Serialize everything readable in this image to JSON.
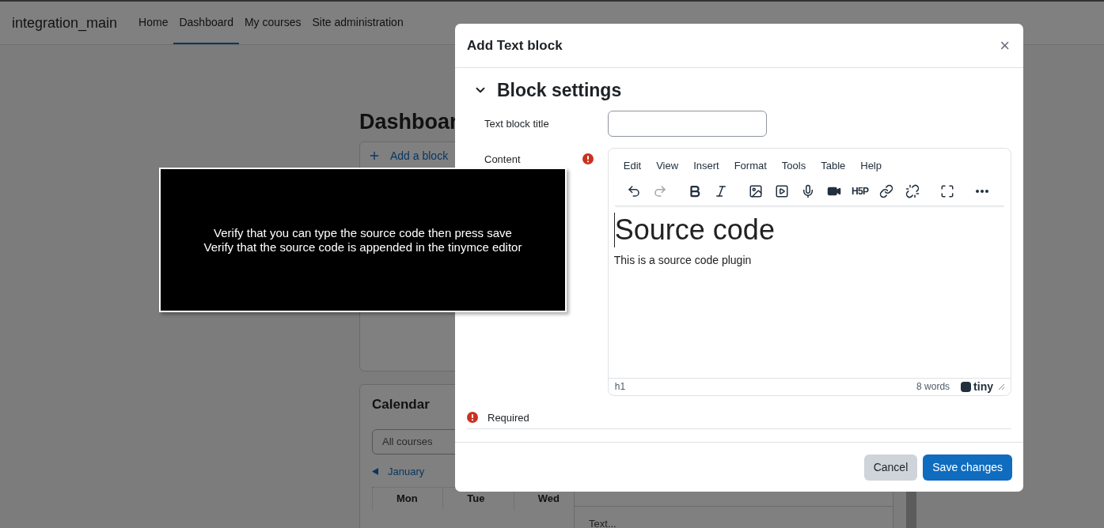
{
  "navbar": {
    "brand": "integration_main",
    "items": [
      {
        "label": "Home",
        "selected": false
      },
      {
        "label": "Dashboard",
        "selected": true
      },
      {
        "label": "My courses",
        "selected": false
      },
      {
        "label": "Site administration",
        "selected": false
      }
    ]
  },
  "page": {
    "title": "Dashboar",
    "add_block": "Add a block",
    "calendar": {
      "title": "Calendar",
      "course_filter": "All courses",
      "month_link": "January",
      "weekdays": [
        "Mon",
        "Tue",
        "Wed"
      ]
    },
    "block_menu": {
      "items": [
        "Text..."
      ]
    }
  },
  "overlay": {
    "lines": [
      "Verify that you can type the source code then press save",
      "Verify that the source code is appended in the tinymce editor"
    ]
  },
  "modal": {
    "title": "Add Text block",
    "close": "×",
    "section": {
      "title": "Block settings",
      "expanded": true
    },
    "title_field": {
      "label": "Text block title"
    },
    "content_field": {
      "label": "Content",
      "required": true,
      "menu": [
        "Edit",
        "View",
        "Insert",
        "Format",
        "Tools",
        "Table",
        "Help"
      ],
      "toolbar": [
        {
          "kind": "undo",
          "disabled": false
        },
        {
          "kind": "redo",
          "disabled": true
        },
        {
          "kind": "bold",
          "disabled": false
        },
        {
          "kind": "italic",
          "disabled": false
        },
        {
          "kind": "image",
          "disabled": false
        },
        {
          "kind": "media",
          "disabled": false
        },
        {
          "kind": "mic",
          "disabled": false
        },
        {
          "kind": "video",
          "disabled": false
        },
        {
          "kind": "h5p",
          "label": "H5P",
          "disabled": false
        },
        {
          "kind": "link",
          "disabled": false
        },
        {
          "kind": "unlink",
          "disabled": false
        },
        {
          "kind": "fullscreen",
          "disabled": false
        },
        {
          "kind": "more",
          "disabled": false
        }
      ],
      "heading": "Source code",
      "paragraph": "This is a source code plugin",
      "path": "h1",
      "word_count": "8 words",
      "branding": "tiny"
    },
    "required_note": "Required",
    "buttons": [
      {
        "label": "Cancel",
        "kind": "secondary"
      },
      {
        "label": "Save changes",
        "kind": "primary"
      }
    ]
  }
}
